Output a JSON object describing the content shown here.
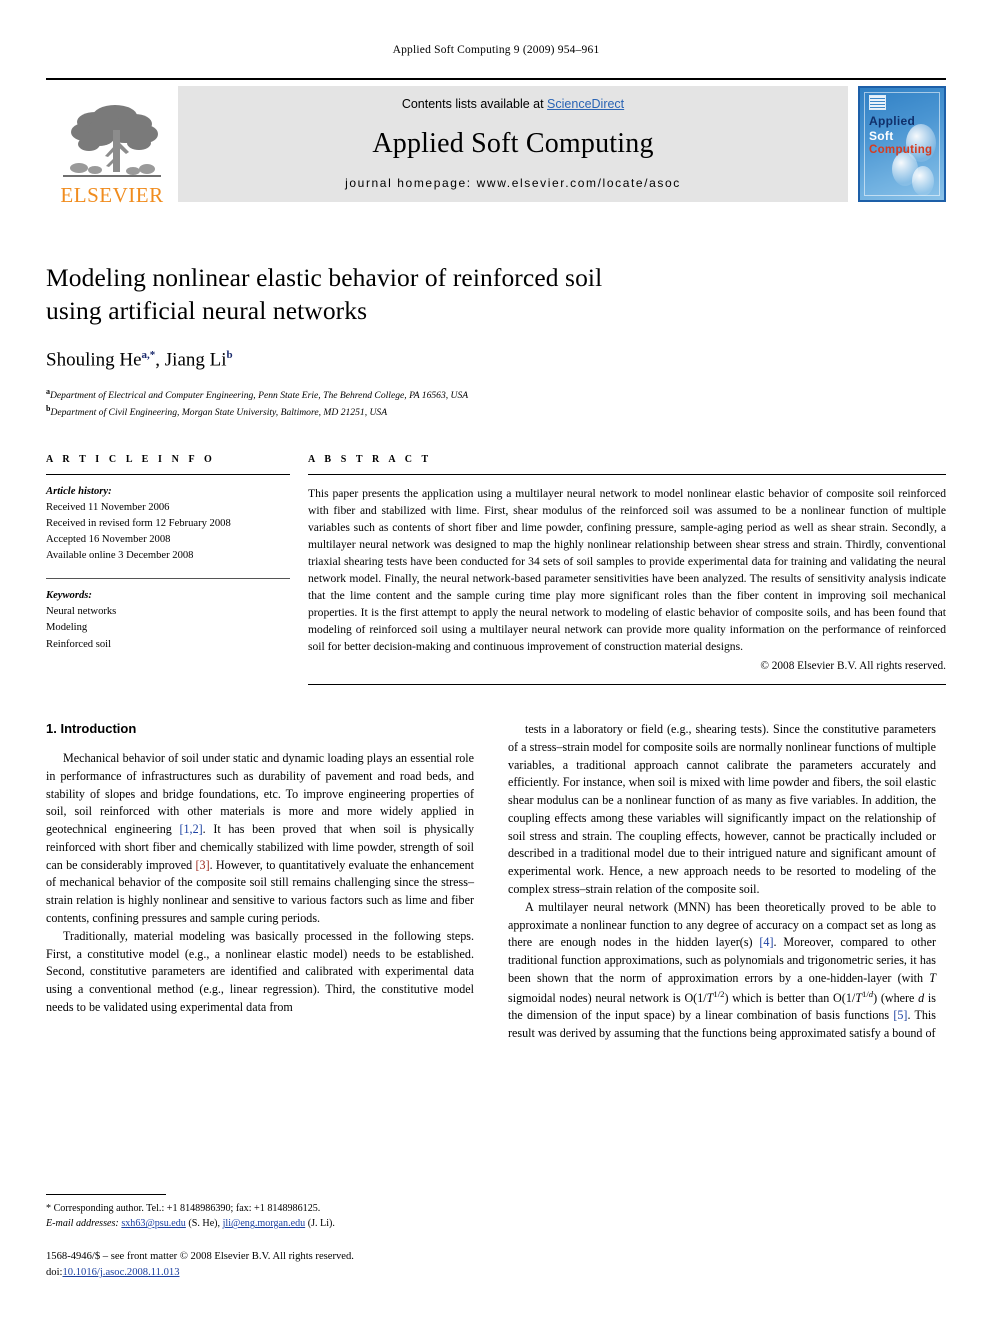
{
  "running_head": "Applied Soft Computing 9 (2009) 954–961",
  "masthead": {
    "publisher_name": "ELSEVIER",
    "contents_prefix": "Contents lists available at ",
    "contents_link": "ScienceDirect",
    "journal_title": "Applied Soft Computing",
    "homepage_line": "journal homepage: www.elsevier.com/locate/asoc",
    "cover": {
      "line1": "Applied",
      "line2": "Soft",
      "line3": "Computing",
      "color_applied": "#10306b",
      "color_soft": "#ffffff",
      "color_computing": "#d63b1f",
      "background": "#4a95d2"
    },
    "link_color": "#2a64b4",
    "elsevier_orange": "#F08C1E"
  },
  "article": {
    "title_line1": "Modeling nonlinear elastic behavior of reinforced soil",
    "title_line2": "using artificial neural networks",
    "authors": [
      {
        "name": "Shouling He",
        "marks": "a,*"
      },
      {
        "name": "Jiang Li",
        "marks": "b"
      }
    ],
    "affiliations": [
      {
        "mark": "a",
        "text": "Department of Electrical and Computer Engineering, Penn State Erie, The Behrend College, PA 16563, USA"
      },
      {
        "mark": "b",
        "text": "Department of Civil Engineering, Morgan State University, Baltimore, MD 21251, USA"
      }
    ]
  },
  "article_info": {
    "tag": "A R T I C L E   I N F O",
    "history_label": "Article history:",
    "history": [
      "Received 11 November 2006",
      "Received in revised form 12 February 2008",
      "Accepted 16 November 2008",
      "Available online 3 December 2008"
    ],
    "keywords_label": "Keywords:",
    "keywords": [
      "Neural networks",
      "Modeling",
      "Reinforced soil"
    ]
  },
  "abstract": {
    "tag": "A B S T R A C T",
    "text": "This paper presents the application using a multilayer neural network to model nonlinear elastic behavior of composite soil reinforced with fiber and stabilized with lime. First, shear modulus of the reinforced soil was assumed to be a nonlinear function of multiple variables such as contents of short fiber and lime powder, confining pressure, sample-aging period as well as shear strain. Secondly, a multilayer neural network was designed to map the highly nonlinear relationship between shear stress and strain. Thirdly, conventional triaxial shearing tests have been conducted for 34 sets of soil samples to provide experimental data for training and validating the neural network model. Finally, the neural network-based parameter sensitivities have been analyzed. The results of sensitivity analysis indicate that the lime content and the sample curing time play more significant roles than the fiber content in improving soil mechanical properties. It is the first attempt to apply the neural network to modeling of elastic behavior of composite soils, and has been found that modeling of reinforced soil using a multilayer neural network can provide more quality information on the performance of reinforced soil for better decision-making and continuous improvement of construction material designs.",
    "copyright": "© 2008 Elsevier B.V. All rights reserved."
  },
  "body": {
    "section1_heading": "1. Introduction",
    "left_paragraphs": [
      "Mechanical behavior of soil under static and dynamic loading plays an essential role in performance of infrastructures such as durability of pavement and road beds, and stability of slopes and bridge foundations, etc. To improve engineering properties of soil, soil reinforced with other materials is more and more widely applied in geotechnical engineering [1,2]. It has been proved that when soil is physically reinforced with short fiber and chemically stabilized with lime powder, strength of soil can be considerably improved [3]. However, to quantitatively evaluate the enhancement of mechanical behavior of the composite soil still remains challenging since the stress–strain relation is highly nonlinear and sensitive to various factors such as lime and fiber contents, confining pressures and sample curing periods.",
      "Traditionally, material modeling was basically processed in the following steps. First, a constitutive model (e.g., a nonlinear elastic model) needs to be established. Second, constitutive parameters are identified and calibrated with experimental data using a conventional method (e.g., linear regression). Third, the constitutive model needs to be validated using experimental data from"
    ],
    "right_paragraphs": [
      "tests in a laboratory or field (e.g., shearing tests). Since the constitutive parameters of a stress–strain model for composite soils are normally nonlinear functions of multiple variables, a traditional approach cannot calibrate the parameters accurately and efficiently. For instance, when soil is mixed with lime powder and fibers, the soil elastic shear modulus can be a nonlinear function of as many as five variables. In addition, the coupling effects among these variables will significantly impact on the relationship of soil stress and strain. The coupling effects, however, cannot be practically included or described in a traditional model due to their intrigued nature and significant amount of experimental work. Hence, a new approach needs to be resorted to modeling of the complex stress–strain relation of the composite soil.",
      "A multilayer neural network (MNN) has been theoretically proved to be able to approximate a nonlinear function to any degree of accuracy on a compact set as long as there are enough nodes in the hidden layer(s) [4]. Moreover, compared to other traditional function approximations, such as polynomials and trigonometric series, it has been shown that the norm of approximation errors by a one-hidden-layer (with T sigmoidal nodes) neural network is O(1/T1/2) which is better than O(1/T1/d) (where d is the dimension of the input space) by a linear combination of basis functions [5]. This result was derived by assuming that the functions being approximated satisfy a bound of"
    ],
    "citations": [
      "[1,2]",
      "[3]",
      "[4]",
      "[5]"
    ]
  },
  "footnotes": {
    "corresponding": "* Corresponding author. Tel.: +1 8148986390; fax: +1 8148986125.",
    "email_label": "E-mail addresses:",
    "email1": "sxh63@psu.edu",
    "email1_person": "(S. He),",
    "email2": "jli@eng.morgan.edu",
    "email2_person": "(J. Li).",
    "issn_line": "1568-4946/$ – see front matter © 2008 Elsevier B.V. All rights reserved.",
    "doi_label": "doi:",
    "doi_value": "10.1016/j.asoc.2008.11.013"
  }
}
